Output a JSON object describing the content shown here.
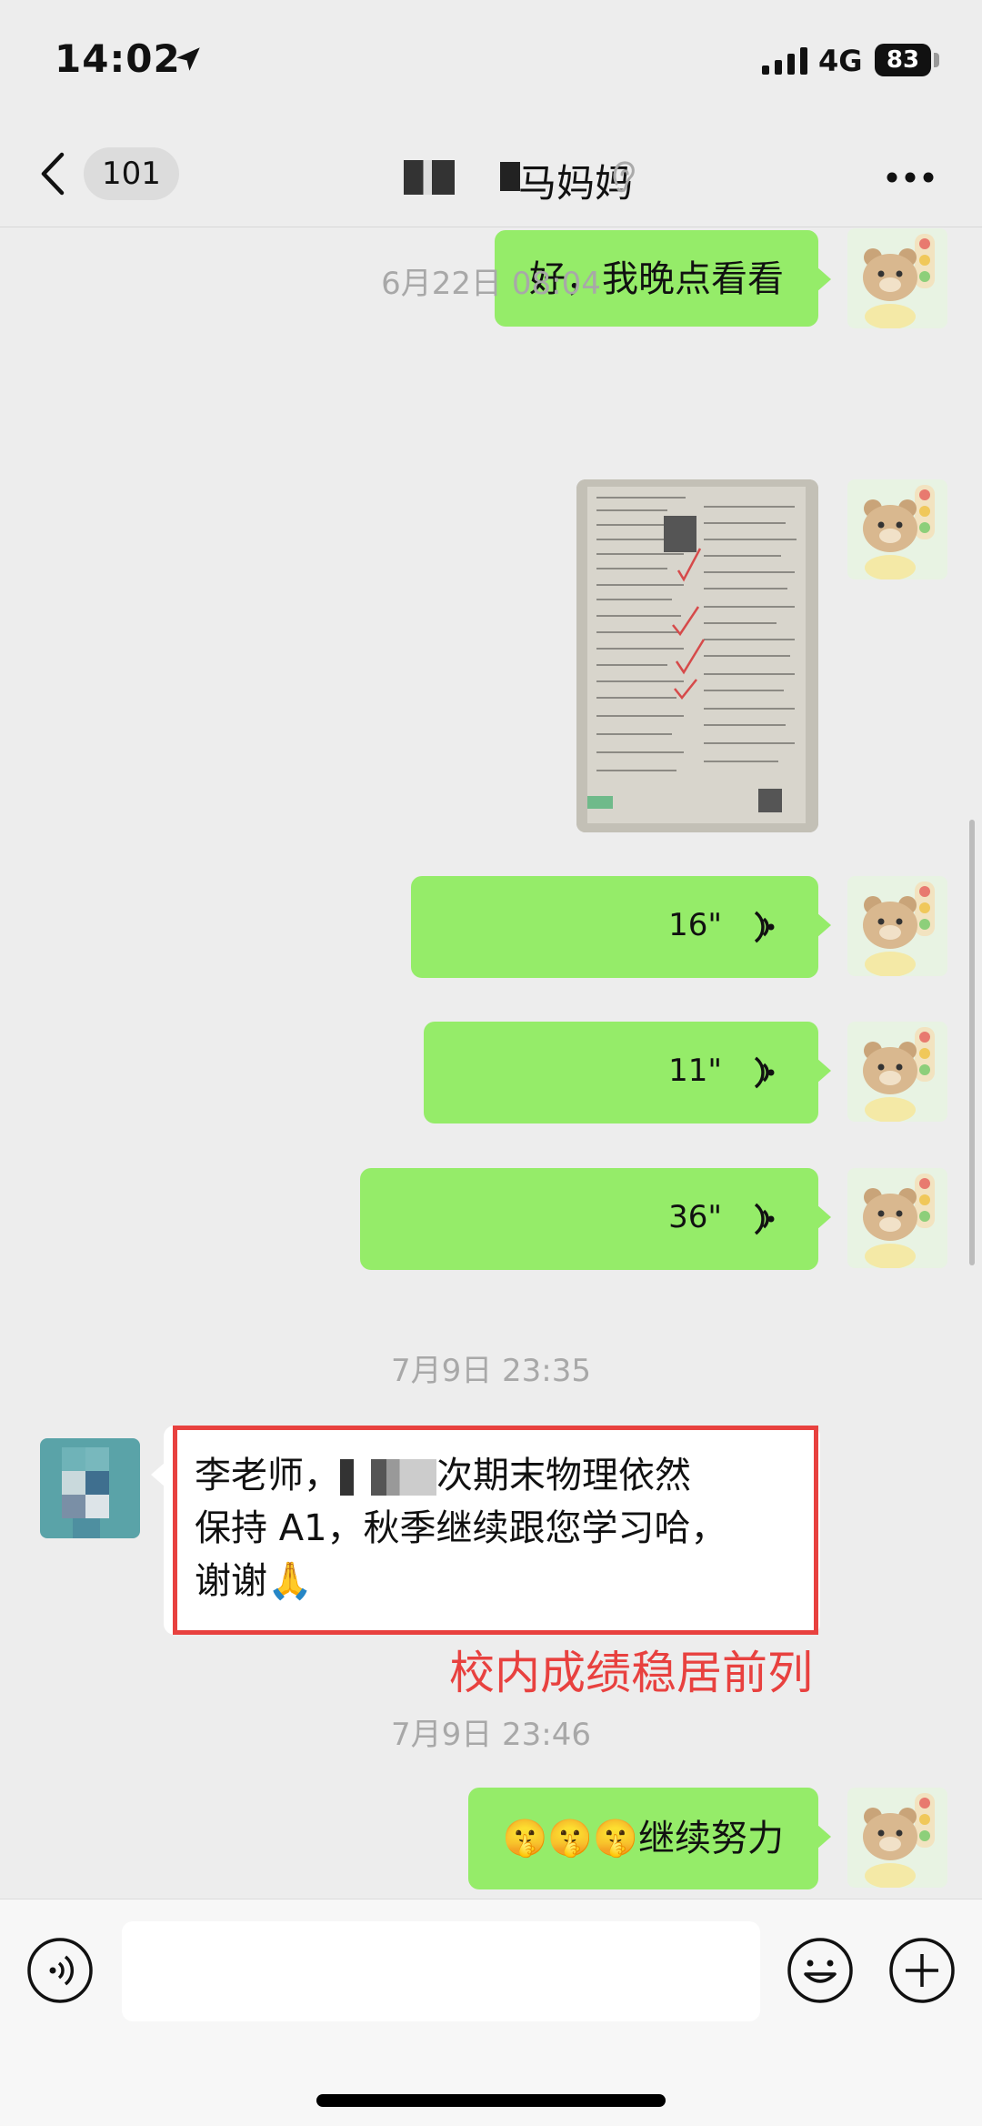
{
  "status_bar": {
    "time": "14:02",
    "network": "4G",
    "battery": "83"
  },
  "nav": {
    "back_count": "101",
    "title": "马妈妈"
  },
  "messages": {
    "m1_text": "好，我晚点看看",
    "ts1": "6月22日 08:04",
    "v1": "16\"",
    "v2": "11\"",
    "v3": "36\"",
    "ts2": "7月9日 23:35",
    "incoming_line1_a": "李老师，",
    "incoming_line1_b": "次期末物理依然",
    "incoming_line2": "保持 A1，秋季继续跟您学习哈，",
    "incoming_line3": "谢谢🙏",
    "annotation": "校内成绩稳居前列",
    "ts3": "7月9日 23:46",
    "last_emoji": "🤫🤫🤫",
    "last_text": "继续努力"
  },
  "colors": {
    "bubble_out": "#95ec69",
    "bubble_in": "#ffffff",
    "highlight": "#e8413f",
    "background": "#ededed"
  }
}
